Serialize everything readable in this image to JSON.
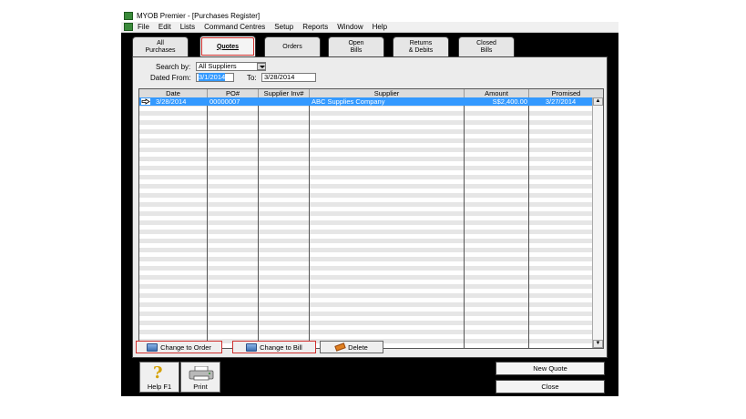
{
  "window": {
    "title": "MYOB Premier - [Purchases Register]"
  },
  "menu": [
    "File",
    "Edit",
    "Lists",
    "Command Centres",
    "Setup",
    "Reports",
    "Window",
    "Help"
  ],
  "tabs": [
    {
      "line1": "All",
      "line2": "Purchases"
    },
    {
      "line1": "Quotes",
      "line2": ""
    },
    {
      "line1": "Orders",
      "line2": ""
    },
    {
      "line1": "Open",
      "line2": "Bills"
    },
    {
      "line1": "Returns",
      "line2": "& Debits"
    },
    {
      "line1": "Closed",
      "line2": "Bills"
    }
  ],
  "active_tab": "Quotes",
  "filters": {
    "search_by_label": "Search by:",
    "search_by_value": "All Suppliers",
    "dated_from_label": "Dated From:",
    "dated_from_value": "3/1/2014",
    "to_label": "To:",
    "to_value": "3/28/2014"
  },
  "table": {
    "columns": [
      "Date",
      "PO#",
      "Supplier Inv#",
      "Supplier",
      "Amount",
      "Promised"
    ],
    "rows": [
      {
        "date": "3/28/2014",
        "po": "00000007",
        "supplier_inv": "",
        "supplier": "ABC Supplies Company",
        "amount": "S$2,400.00",
        "promised": "3/27/2014"
      }
    ]
  },
  "buttons": {
    "change_to_order": "Change to Order",
    "change_to_bill": "Change to Bill",
    "delete": "Delete",
    "help": "Help F1",
    "print": "Print",
    "new_quote": "New Quote",
    "close": "Close"
  },
  "icons": {
    "row_pointer": "row-pointer-icon",
    "help": "help-question-icon",
    "print": "printer-icon"
  },
  "colors": {
    "selection": "#3399ff",
    "highlight_outline": "#d0302e",
    "window_frame": "#000000"
  }
}
